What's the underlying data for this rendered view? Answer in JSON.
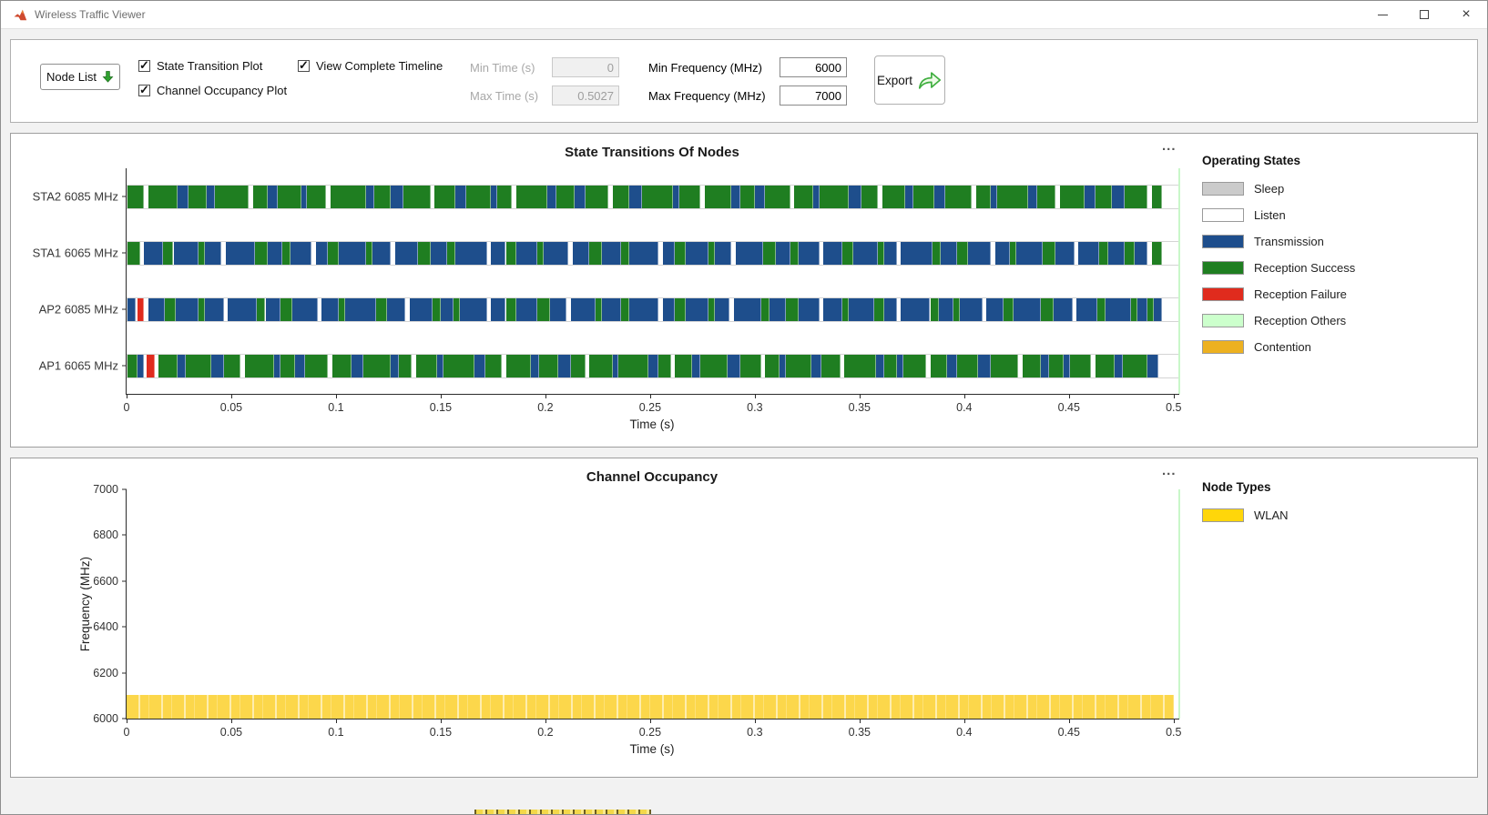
{
  "window": {
    "title": "Wireless Traffic Viewer",
    "icons": {
      "close_glyph": "×"
    }
  },
  "toolbar": {
    "node_list_label": "Node List",
    "checkboxes": [
      {
        "label": "State Transition Plot",
        "checked": true
      },
      {
        "label": "Channel Occupancy Plot",
        "checked": true
      },
      {
        "label": "View Complete Timeline",
        "checked": true
      }
    ],
    "min_time": {
      "label": "Min Time (s)",
      "value": "0",
      "enabled": false
    },
    "max_time": {
      "label": "Max Time (s)",
      "value": "0.5027",
      "enabled": false
    },
    "min_freq": {
      "label": "Min Frequency (MHz)",
      "value": "6000",
      "enabled": true
    },
    "max_freq": {
      "label": "Max Frequency (MHz)",
      "value": "7000",
      "enabled": true
    },
    "export_label": "Export"
  },
  "panels": {
    "menu_glyph": "..."
  },
  "chart_data": [
    {
      "type": "state-timeline",
      "title": "State Transitions Of Nodes",
      "xlabel": "Time (s)",
      "xlim": [
        0,
        0.5027
      ],
      "xticks": [
        0,
        0.05,
        0.1,
        0.15,
        0.2,
        0.25,
        0.3,
        0.35,
        0.4,
        0.45,
        0.5
      ],
      "xtick_labels": [
        "0",
        "0.05",
        "0.1",
        "0.15",
        "0.2",
        "0.25",
        "0.3",
        "0.35",
        "0.4",
        "0.45",
        "0.5"
      ],
      "grid": false,
      "legend_title": "Operating States",
      "legend_position": "right",
      "legend": [
        {
          "label": "Sleep",
          "color": "#cbcbcb"
        },
        {
          "label": "Listen",
          "color": "#ffffff"
        },
        {
          "label": "Transmission",
          "color": "#1e4e8c"
        },
        {
          "label": "Reception Success",
          "color": "#1f7e21"
        },
        {
          "label": "Reception Failure",
          "color": "#e02b1d"
        },
        {
          "label": "Reception Others",
          "color": "#ccffcc"
        },
        {
          "label": "Contention",
          "color": "#edb120"
        }
      ],
      "state_colors": {
        "T": "#1e4e8c",
        "R": "#1f7e21",
        "F": "#e02b1d",
        "L": "#ffffff"
      },
      "state_names": {
        "T": "Transmission",
        "R": "Reception Success",
        "F": "Reception Failure",
        "L": "Listen"
      },
      "end_marker": {
        "time": 0.5027,
        "color": "#c9f7c9"
      },
      "rows": [
        {
          "label": "STA2 6085 MHz",
          "segments_ms": "8R 2L 14R 5T 9R 4T 16R 2L 7R 5T 11R 3T 9R 2L 17R 4T 8R 6T 13R 2L 10R 5T 12R 3T 7R 2L 15R 4T 9R 5T 11R 2L 8R 6T 15R 3T 10R 2L 13R 4T 7R 5T 12R 2L 9R 3T 14R 6T 8R 2L 11R 4T 10R 5T 13R 2L 7R 3T 15R 4T 9R 2L 12R 5T 8R 6T 11R 2L 5R"
        },
        {
          "label": "STA1 6065 MHz",
          "segments_ms": "6R 2L 9T 5R 12T 3R 8T 2L 14T 6R 7T 4R 10T 2L 6T 5R 13T 3R 9T 2L 11T 6R 8T 4R 15T 2L 7T 5R 10T 3R 12T 2L 8T 6R 9T 4R 14T 2L 6T 5R 11T 3R 8T 2L 13T 6R 7T 4R 10T 2L 9T 5R 12T 3R 6T 2L 15T 4R 8T 5R 11T 2L 7T 3R 13T 6R 9T 2L 10T 4R 8T 5R 6T 2L 5R"
        },
        {
          "label": "AP2 6085 MHz",
          "segments_ms": "4T 1L 3F 2L 8T 5R 11T 3R 9T 2L 14T 4R 7T 6R 12T 2L 8T 3R 15T 5R 9T 2L 11T 4R 6T 3R 13T 2L 7T 5R 10T 6R 8T 2L 12T 3R 9T 4R 14T 2L 6T 5R 11T 3R 7T 2L 13T 4R 8T 6R 10T 2L 9T 3R 12T 5R 6T 2L 14T 4R 7T 3R 11T 2L 8T 5R 13T 6R 9T 2L 10T 4R 12T 3R 5T 3R 4T"
        },
        {
          "label": "AP1 6065 MHz",
          "segments_ms": "5R 3T 1L 4F 2L 9R 4T 12R 6T 8R 2L 14R 3T 7R 5T 11R 2L 9R 6T 13R 4T 6R 2L 10R 3T 15R 5T 8R 2L 12R 4T 9R 6T 7R 2L 11R 3T 14R 5T 6R 2L 8R 4T 13R 6T 10R 2L 7R 3T 12R 5T 9R 2L 15R 4T 6R 3T 11R 2L 8R 5T 10R 6T 13R 2L 9R 4T 7R 3T 10R 2L 9R 4T 12R 5T"
        }
      ]
    },
    {
      "type": "occupancy",
      "title": "Channel Occupancy",
      "xlabel": "Time (s)",
      "ylabel": "Frequency (MHz)",
      "xlim": [
        0,
        0.5027
      ],
      "ylim": [
        6000,
        7000
      ],
      "yticks": [
        6000,
        6200,
        6400,
        6600,
        6800,
        7000
      ],
      "xticks": [
        0,
        0.05,
        0.1,
        0.15,
        0.2,
        0.25,
        0.3,
        0.35,
        0.4,
        0.45,
        0.5
      ],
      "xtick_labels": [
        "0",
        "0.05",
        "0.1",
        "0.15",
        "0.2",
        "0.25",
        "0.3",
        "0.35",
        "0.4",
        "0.45",
        "0.5"
      ],
      "grid": false,
      "legend_title": "Node Types",
      "legend_position": "right",
      "legend": [
        {
          "label": "WLAN",
          "color": "#ffd60a"
        }
      ],
      "bands": [
        {
          "node_type": "WLAN",
          "freq_min": 6000,
          "freq_max": 6105,
          "t_start": 0,
          "t_end": 0.5,
          "color": "#fcd74b"
        }
      ],
      "end_marker": {
        "time": 0.5027,
        "color": "#c9f7c9"
      }
    }
  ]
}
